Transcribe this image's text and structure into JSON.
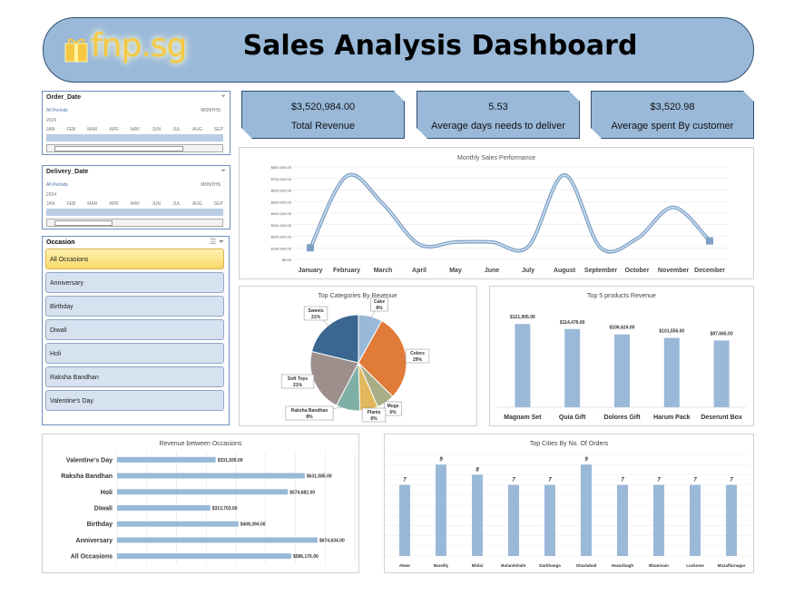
{
  "header": {
    "logo_text": "fnp.sg",
    "title": "Sales Analysis Dashboard"
  },
  "order_date_slicer": {
    "title": "Order_Date",
    "periods": "All  Periods",
    "level": "MONTHS",
    "year": "2024",
    "months": [
      "JAN",
      "FEB",
      "MAR",
      "APR",
      "MAY",
      "JUN",
      "JUL",
      "AUG",
      "SEP"
    ]
  },
  "delivery_date_slicer": {
    "title": "Delivery_Date",
    "periods": "All  Periods",
    "level": "MONTHS",
    "year": "2024",
    "months": [
      "JAN",
      "FEB",
      "MAR",
      "APR",
      "MAY",
      "JUN",
      "JUL",
      "AUG",
      "SEP"
    ]
  },
  "occasion_slicer": {
    "title": "Occasion",
    "items": [
      "All Occasions",
      "Anniversary",
      "Birthday",
      "Diwali",
      "Holi",
      "Raksha Bandhan",
      "Valentine's Day"
    ],
    "selected": "All Occasions"
  },
  "kpis": [
    {
      "value": "$3,520,984.00",
      "label": "Total Revenue"
    },
    {
      "value": "5.53",
      "label": "Average days needs to deliver"
    },
    {
      "value": "$3,520.98",
      "label": "Average spent By customer"
    }
  ],
  "colors": {
    "header": "#9ab9d9",
    "bar": "#9ab9d9",
    "line": "#8fb0d3"
  },
  "chart_data": [
    {
      "type": "line",
      "title": "Monthly Sales Performance",
      "categories": [
        "January",
        "February",
        "March",
        "April",
        "May",
        "June",
        "July",
        "August",
        "September",
        "October",
        "November",
        "December"
      ],
      "values": [
        100000,
        720000,
        480000,
        130000,
        150000,
        150000,
        110000,
        730000,
        100000,
        180000,
        450000,
        160000
      ],
      "ylim": [
        0,
        800000
      ],
      "yticks": [
        "$0.00",
        "$100,000.00",
        "$200,000.00",
        "$300,000.00",
        "$400,000.00",
        "$500,000.00",
        "$600,000.00",
        "$700,000.00",
        "$800,000.00"
      ]
    },
    {
      "type": "pie",
      "title": "Top Categories By Revenue",
      "slices": [
        {
          "label": "Cake",
          "pct": "8%",
          "value": 8,
          "color": "#9ab9d9"
        },
        {
          "label": "Colors",
          "pct": "29%",
          "value": 29,
          "color": "#e07b39"
        },
        {
          "label": "Mugs",
          "pct": "6%",
          "value": 6,
          "color": "#a9ae87"
        },
        {
          "label": "Plants",
          "pct": "6%",
          "value": 6,
          "color": "#e0b75a"
        },
        {
          "label": "Raksha Bandhan",
          "pct": "8%",
          "value": 8,
          "color": "#7fb0a6"
        },
        {
          "label": "Soft Toys",
          "pct": "21%",
          "value": 21,
          "color": "#9c8f8c"
        },
        {
          "label": "Sweets",
          "pct": "21%",
          "value": 21,
          "color": "#3a6690"
        }
      ]
    },
    {
      "type": "bar",
      "title": "Top 5 products Revenue",
      "categories": [
        "Magnam Set",
        "Quia Gift",
        "Dolores Gift",
        "Harum Pack",
        "Deserunt Box"
      ],
      "values": [
        121905,
        114476,
        106624,
        101556,
        97665
      ],
      "labels": [
        "$121,905.00",
        "$114,476.00",
        "$106,624.00",
        "$101,556.00",
        "$97,665.00"
      ],
      "ylim": [
        0,
        150000
      ]
    },
    {
      "type": "bar",
      "orientation": "horizontal",
      "title": "Revenue between Occasions",
      "categories": [
        "Valentine's Day",
        "Raksha Bandhan",
        "Holi",
        "Diwali",
        "Birthday",
        "Anniversary",
        "All Occasions"
      ],
      "values": [
        331930,
        631585,
        574682,
        313703,
        408394,
        674634,
        586176
      ],
      "labels": [
        "$331,930.00",
        "$631,585.00",
        "$574,682.00",
        "$313,703.00",
        "$408,394.00",
        "$674,634.00",
        "$586,176.00"
      ],
      "xlim": [
        0,
        800000
      ]
    },
    {
      "type": "bar",
      "title": "Top Cities By No. Of Orders",
      "categories": [
        "Alwar",
        "Bareilly",
        "Bhilai",
        "Bulandshahr",
        "Darbhanga",
        "Ghaziabad",
        "Hazaribagh",
        "Bhamnam",
        "Lucknow",
        "Muzaffarnagar"
      ],
      "values": [
        7,
        9,
        8,
        7,
        7,
        9,
        7,
        7,
        7,
        7
      ],
      "ylim": [
        0,
        10
      ]
    }
  ]
}
